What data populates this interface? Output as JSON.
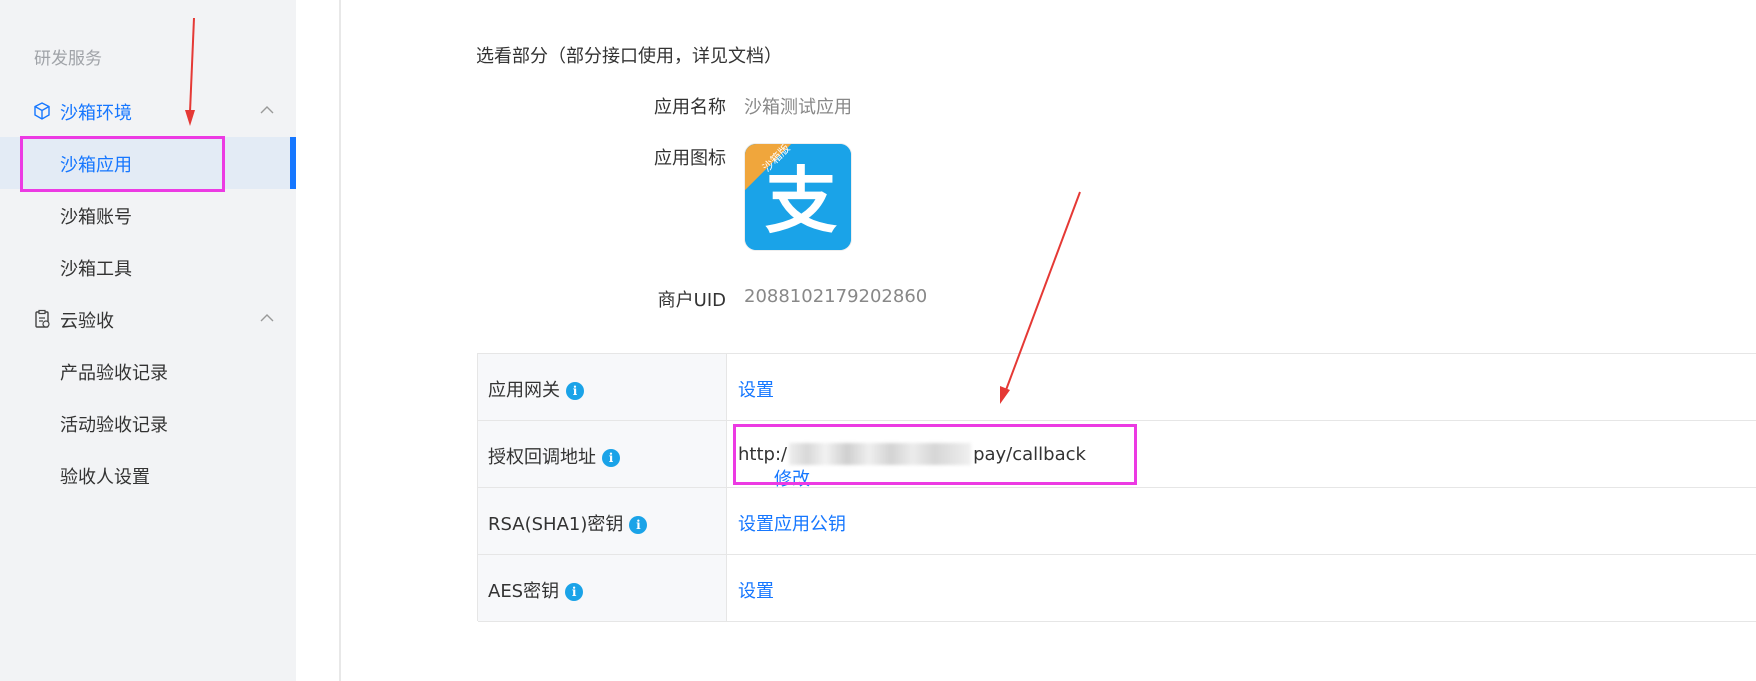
{
  "sidebar": {
    "section_title": "研发服务",
    "groups": [
      {
        "label": "沙箱环境",
        "icon": "cube-icon",
        "expanded": true,
        "active": true,
        "items": [
          {
            "label": "沙箱应用",
            "selected": true
          },
          {
            "label": "沙箱账号",
            "selected": false
          },
          {
            "label": "沙箱工具",
            "selected": false
          }
        ]
      },
      {
        "label": "云验收",
        "icon": "clipboard-icon",
        "expanded": true,
        "active": false,
        "items": [
          {
            "label": "产品验收记录",
            "selected": false
          },
          {
            "label": "活动验收记录",
            "selected": false
          },
          {
            "label": "验收人设置",
            "selected": false
          }
        ]
      }
    ]
  },
  "main": {
    "intro": "选看部分（部分接口使用，详见文档）",
    "app_name_label": "应用名称",
    "app_name_value": "沙箱测试应用",
    "app_icon_label": "应用图标",
    "app_icon": {
      "glyph": "支",
      "ribbon": "沙箱版",
      "bg": "#1aa3e8",
      "ribbon_color": "#f0a63c"
    },
    "merchant_uid_label": "商户UID",
    "merchant_uid_value": "2088102179202860",
    "table": [
      {
        "label": "应用网关",
        "value_link": "设置"
      },
      {
        "label": "授权回调地址",
        "value_prefix": "http:/",
        "value_suffix": "pay/callback",
        "value_link": "修改"
      },
      {
        "label": "RSA(SHA1)密钥",
        "value_link": "设置应用公钥"
      },
      {
        "label": "AES密钥",
        "value_link": "设置"
      }
    ],
    "info_badge": "i"
  },
  "colors": {
    "accent": "#1677ff",
    "highlight": "#ec3ae3",
    "arrow": "#e53935"
  }
}
